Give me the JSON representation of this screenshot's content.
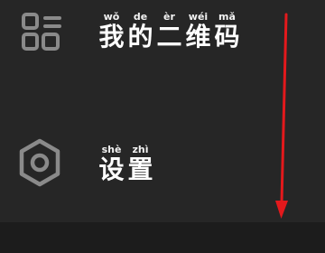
{
  "menu": {
    "items": [
      {
        "icon": "qr-code-icon",
        "chars": [
          {
            "hanzi": "我",
            "pinyin": "wǒ"
          },
          {
            "hanzi": "的",
            "pinyin": "de"
          },
          {
            "hanzi": "二",
            "pinyin": "èr"
          },
          {
            "hanzi": "维",
            "pinyin": "wéi"
          },
          {
            "hanzi": "码",
            "pinyin": "mǎ"
          }
        ]
      },
      {
        "icon": "settings-hexagon-icon",
        "chars": [
          {
            "hanzi": "设",
            "pinyin": "shè"
          },
          {
            "hanzi": "置",
            "pinyin": "zhì"
          }
        ]
      }
    ]
  },
  "colors": {
    "background": "#262626",
    "icon": "#8a8a8a",
    "text": "#ffffff",
    "annotation_arrow": "#e3191c"
  }
}
